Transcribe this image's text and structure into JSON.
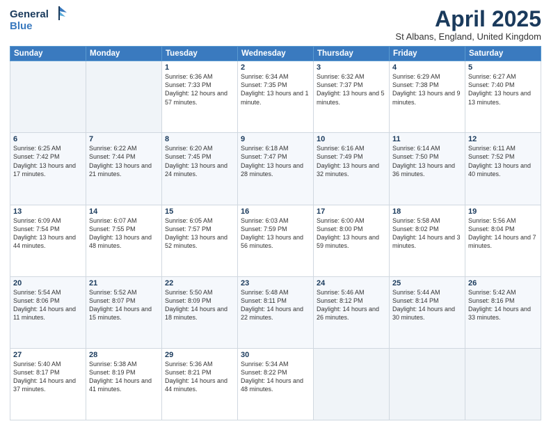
{
  "header": {
    "logo_line1": "General",
    "logo_line2": "Blue",
    "month_title": "April 2025",
    "location": "St Albans, England, United Kingdom"
  },
  "days_of_week": [
    "Sunday",
    "Monday",
    "Tuesday",
    "Wednesday",
    "Thursday",
    "Friday",
    "Saturday"
  ],
  "weeks": [
    [
      {
        "day": "",
        "info": ""
      },
      {
        "day": "",
        "info": ""
      },
      {
        "day": "1",
        "info": "Sunrise: 6:36 AM\nSunset: 7:33 PM\nDaylight: 12 hours and 57 minutes."
      },
      {
        "day": "2",
        "info": "Sunrise: 6:34 AM\nSunset: 7:35 PM\nDaylight: 13 hours and 1 minute."
      },
      {
        "day": "3",
        "info": "Sunrise: 6:32 AM\nSunset: 7:37 PM\nDaylight: 13 hours and 5 minutes."
      },
      {
        "day": "4",
        "info": "Sunrise: 6:29 AM\nSunset: 7:38 PM\nDaylight: 13 hours and 9 minutes."
      },
      {
        "day": "5",
        "info": "Sunrise: 6:27 AM\nSunset: 7:40 PM\nDaylight: 13 hours and 13 minutes."
      }
    ],
    [
      {
        "day": "6",
        "info": "Sunrise: 6:25 AM\nSunset: 7:42 PM\nDaylight: 13 hours and 17 minutes."
      },
      {
        "day": "7",
        "info": "Sunrise: 6:22 AM\nSunset: 7:44 PM\nDaylight: 13 hours and 21 minutes."
      },
      {
        "day": "8",
        "info": "Sunrise: 6:20 AM\nSunset: 7:45 PM\nDaylight: 13 hours and 24 minutes."
      },
      {
        "day": "9",
        "info": "Sunrise: 6:18 AM\nSunset: 7:47 PM\nDaylight: 13 hours and 28 minutes."
      },
      {
        "day": "10",
        "info": "Sunrise: 6:16 AM\nSunset: 7:49 PM\nDaylight: 13 hours and 32 minutes."
      },
      {
        "day": "11",
        "info": "Sunrise: 6:14 AM\nSunset: 7:50 PM\nDaylight: 13 hours and 36 minutes."
      },
      {
        "day": "12",
        "info": "Sunrise: 6:11 AM\nSunset: 7:52 PM\nDaylight: 13 hours and 40 minutes."
      }
    ],
    [
      {
        "day": "13",
        "info": "Sunrise: 6:09 AM\nSunset: 7:54 PM\nDaylight: 13 hours and 44 minutes."
      },
      {
        "day": "14",
        "info": "Sunrise: 6:07 AM\nSunset: 7:55 PM\nDaylight: 13 hours and 48 minutes."
      },
      {
        "day": "15",
        "info": "Sunrise: 6:05 AM\nSunset: 7:57 PM\nDaylight: 13 hours and 52 minutes."
      },
      {
        "day": "16",
        "info": "Sunrise: 6:03 AM\nSunset: 7:59 PM\nDaylight: 13 hours and 56 minutes."
      },
      {
        "day": "17",
        "info": "Sunrise: 6:00 AM\nSunset: 8:00 PM\nDaylight: 13 hours and 59 minutes."
      },
      {
        "day": "18",
        "info": "Sunrise: 5:58 AM\nSunset: 8:02 PM\nDaylight: 14 hours and 3 minutes."
      },
      {
        "day": "19",
        "info": "Sunrise: 5:56 AM\nSunset: 8:04 PM\nDaylight: 14 hours and 7 minutes."
      }
    ],
    [
      {
        "day": "20",
        "info": "Sunrise: 5:54 AM\nSunset: 8:06 PM\nDaylight: 14 hours and 11 minutes."
      },
      {
        "day": "21",
        "info": "Sunrise: 5:52 AM\nSunset: 8:07 PM\nDaylight: 14 hours and 15 minutes."
      },
      {
        "day": "22",
        "info": "Sunrise: 5:50 AM\nSunset: 8:09 PM\nDaylight: 14 hours and 18 minutes."
      },
      {
        "day": "23",
        "info": "Sunrise: 5:48 AM\nSunset: 8:11 PM\nDaylight: 14 hours and 22 minutes."
      },
      {
        "day": "24",
        "info": "Sunrise: 5:46 AM\nSunset: 8:12 PM\nDaylight: 14 hours and 26 minutes."
      },
      {
        "day": "25",
        "info": "Sunrise: 5:44 AM\nSunset: 8:14 PM\nDaylight: 14 hours and 30 minutes."
      },
      {
        "day": "26",
        "info": "Sunrise: 5:42 AM\nSunset: 8:16 PM\nDaylight: 14 hours and 33 minutes."
      }
    ],
    [
      {
        "day": "27",
        "info": "Sunrise: 5:40 AM\nSunset: 8:17 PM\nDaylight: 14 hours and 37 minutes."
      },
      {
        "day": "28",
        "info": "Sunrise: 5:38 AM\nSunset: 8:19 PM\nDaylight: 14 hours and 41 minutes."
      },
      {
        "day": "29",
        "info": "Sunrise: 5:36 AM\nSunset: 8:21 PM\nDaylight: 14 hours and 44 minutes."
      },
      {
        "day": "30",
        "info": "Sunrise: 5:34 AM\nSunset: 8:22 PM\nDaylight: 14 hours and 48 minutes."
      },
      {
        "day": "",
        "info": ""
      },
      {
        "day": "",
        "info": ""
      },
      {
        "day": "",
        "info": ""
      }
    ]
  ]
}
